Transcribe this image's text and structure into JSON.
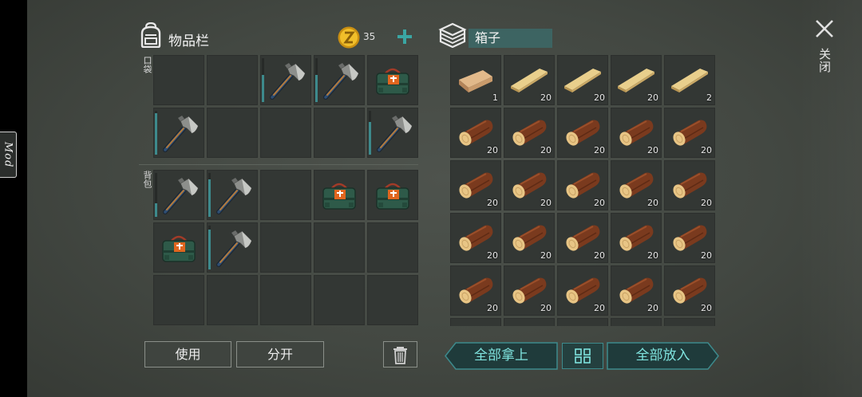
{
  "inventory": {
    "title": "物品栏",
    "coins": "35",
    "pocket_label": "口袋",
    "backpack_label": "背包",
    "pockets": [
      {
        "item": null
      },
      {
        "item": null
      },
      {
        "item": "hatchet",
        "durability": 0.62
      },
      {
        "item": "hatchet",
        "durability": 0.62
      },
      {
        "item": "first-aid-bag"
      },
      {
        "item": "hatchet",
        "durability": 0.95
      },
      {
        "item": null
      },
      {
        "item": null
      },
      {
        "item": null
      },
      {
        "item": "hatchet",
        "durability": 0.75
      }
    ],
    "backpack": [
      {
        "item": "hatchet",
        "durability": 0.3
      },
      {
        "item": "hatchet",
        "durability": 0.85
      },
      {
        "item": null
      },
      {
        "item": "first-aid-bag"
      },
      {
        "item": "first-aid-bag"
      },
      {
        "item": "first-aid-bag"
      },
      {
        "item": "hatchet",
        "durability": 0.9
      },
      {
        "item": null
      },
      {
        "item": null
      },
      {
        "item": null
      },
      {
        "item": null
      },
      {
        "item": null
      },
      {
        "item": null
      },
      {
        "item": null
      },
      {
        "item": null
      }
    ]
  },
  "box": {
    "title": "箱子",
    "slots": [
      {
        "item": "plank-light",
        "qty": "1"
      },
      {
        "item": "plank",
        "qty": "20"
      },
      {
        "item": "plank",
        "qty": "20"
      },
      {
        "item": "plank",
        "qty": "20"
      },
      {
        "item": "plank",
        "qty": "2"
      },
      {
        "item": "log",
        "qty": "20"
      },
      {
        "item": "log",
        "qty": "20"
      },
      {
        "item": "log",
        "qty": "20"
      },
      {
        "item": "log",
        "qty": "20"
      },
      {
        "item": "log",
        "qty": "20"
      },
      {
        "item": "log",
        "qty": "20"
      },
      {
        "item": "log",
        "qty": "20"
      },
      {
        "item": "log",
        "qty": "20"
      },
      {
        "item": "log",
        "qty": "20"
      },
      {
        "item": "log",
        "qty": "20"
      },
      {
        "item": "log",
        "qty": "20"
      },
      {
        "item": "log",
        "qty": "20"
      },
      {
        "item": "log",
        "qty": "20"
      },
      {
        "item": "log",
        "qty": "20"
      },
      {
        "item": "log",
        "qty": "20"
      },
      {
        "item": "log",
        "qty": "20"
      },
      {
        "item": "log",
        "qty": "20"
      },
      {
        "item": "log",
        "qty": "20"
      },
      {
        "item": "log",
        "qty": "20"
      },
      {
        "item": "log",
        "qty": "20"
      },
      {
        "item": null
      },
      {
        "item": null
      },
      {
        "item": null
      },
      {
        "item": null
      },
      {
        "item": null
      }
    ]
  },
  "buttons": {
    "use": "使用",
    "split": "分开",
    "take_all": "全部拿上",
    "put_all": "全部放入",
    "close": "关闭",
    "mod": "Mod"
  },
  "icons": {
    "backpack": "backpack-icon",
    "coin": "coin-icon",
    "plus": "plus-icon",
    "box": "box-icon",
    "close": "close-icon",
    "trash": "trash-icon",
    "sort": "grid-sort-icon"
  },
  "colors": {
    "accent": "#3d8a8c",
    "accent_text": "#7fe3de",
    "coin": "#e8b21c"
  }
}
